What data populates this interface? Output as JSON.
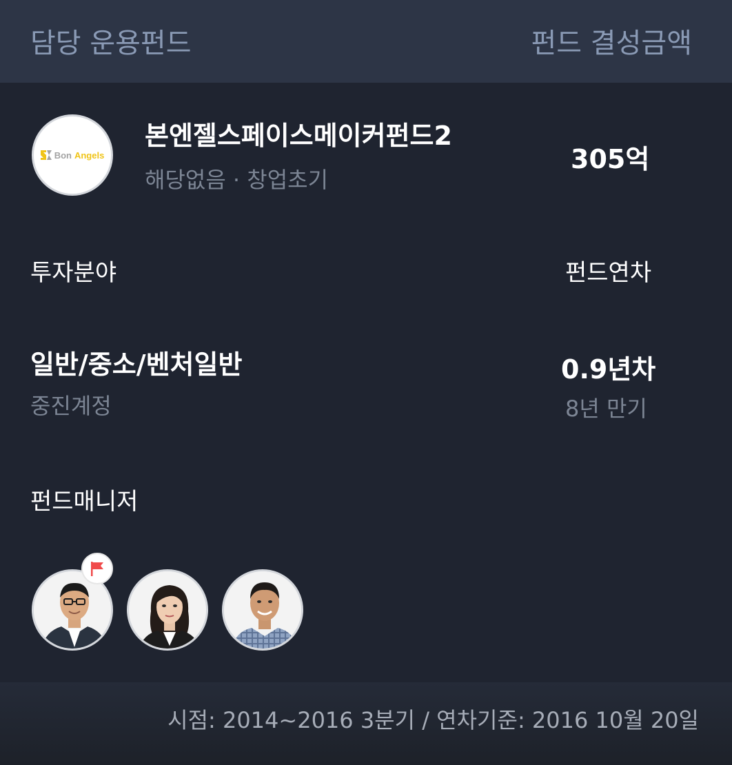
{
  "header": {
    "left_label": "담당 운용펀드",
    "right_label": "펀드 결성금액"
  },
  "fund": {
    "logo_text_bon": "Bon",
    "logo_text_angels": "Angels",
    "name": "본엔젤스페이스메이커펀드2",
    "sub": "해당없음 · 창업초기",
    "amount": "305억"
  },
  "labels": {
    "field": "투자분야",
    "year": "펀드연차",
    "managers": "펀드매니저"
  },
  "field": {
    "value": "일반/중소/벤처일반",
    "sub": "중진계정"
  },
  "year": {
    "value": "0.9년차",
    "sub": "8년 만기"
  },
  "managers": [
    {
      "icon": "manager-avatar-1",
      "flag": true
    },
    {
      "icon": "manager-avatar-2",
      "flag": false
    },
    {
      "icon": "manager-avatar-3",
      "flag": false
    }
  ],
  "footer": {
    "text": "시점: 2014~2016 3분기 / 연차기준: 2016 10월 20일"
  },
  "colors": {
    "header_bg": "#2d3546",
    "main_bg": "#1f2430",
    "muted_text": "#7c8594",
    "header_text": "#8a9ab5",
    "flag_red": "#f04a4a",
    "logo_yellow": "#f0c419"
  }
}
